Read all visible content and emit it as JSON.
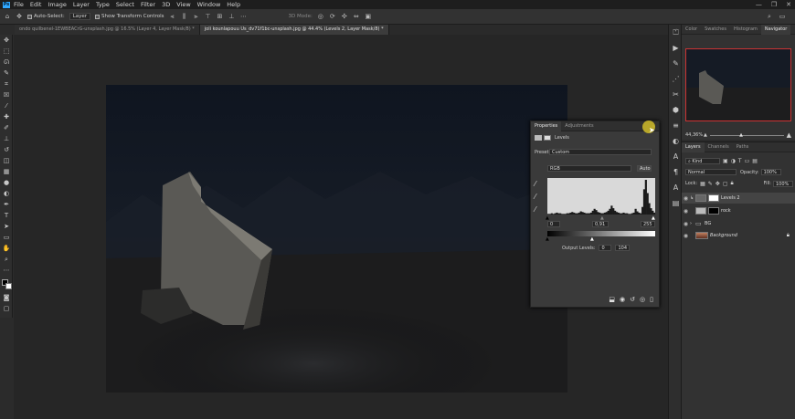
{
  "menu": {
    "logo": "Ps",
    "items": [
      "File",
      "Edit",
      "Image",
      "Layer",
      "Type",
      "Select",
      "Filter",
      "3D",
      "View",
      "Window",
      "Help"
    ],
    "window_controls": [
      "—",
      "❐",
      "✕"
    ]
  },
  "options": {
    "autoselect_label": "Auto-Select:",
    "autoselect_target": "Layer",
    "show_transform_label": "Show Transform Controls",
    "mode_3d": "3D Mode:"
  },
  "tabs": [
    {
      "label": "ondo quilbenel-1EWBEACrG-unsplash.jpg @ 16.5% (Layer 4, Layer Mask/8) *",
      "active": false
    },
    {
      "label": "joli kounlapouu Us_dv71f1bc-unsplash.jpg @ 44.4% (Levels 2, Layer Mask/8) *",
      "active": true
    }
  ],
  "properties": {
    "tab_properties": "Properties",
    "tab_adjustments": "Adjustments",
    "title": "Levels",
    "preset_label": "Preset:",
    "preset_value": "Custom",
    "channel_value": "RGB",
    "auto_label": "Auto",
    "input_black": "0",
    "input_gamma": "0,91",
    "input_white": "255",
    "output_label": "Output Levels:",
    "output_black": "0",
    "output_white": "104",
    "histogram": [
      1,
      1,
      2,
      1,
      2,
      3,
      2,
      2,
      1,
      1,
      1,
      2,
      2,
      3,
      4,
      3,
      2,
      2,
      3,
      5,
      4,
      3,
      2,
      2,
      2,
      3,
      6,
      9,
      7,
      4,
      3,
      2,
      2,
      3,
      4,
      6,
      9,
      14,
      10,
      6,
      4,
      3,
      2,
      2,
      3,
      2,
      2,
      1,
      1,
      2,
      3,
      9,
      5,
      3,
      2,
      12,
      40,
      55,
      34,
      18,
      10,
      6,
      3
    ]
  },
  "navigator": {
    "tabs": [
      "Color",
      "Swatches",
      "Histogram",
      "Navigator"
    ],
    "zoom": "44,36%"
  },
  "layers": {
    "tabs": [
      "Layers",
      "Channels",
      "Paths"
    ],
    "kind_label": "Kind",
    "blend_mode": "Normal",
    "opacity_label": "Opacity:",
    "opacity_value": "100%",
    "lock_label": "Lock:",
    "fill_label": "Fill:",
    "fill_value": "100%",
    "rows": [
      {
        "name": "Levels 2",
        "selected": true
      },
      {
        "name": "rock",
        "selected": false
      },
      {
        "name": "BG",
        "selected": false
      },
      {
        "name": "Background",
        "selected": false
      }
    ]
  }
}
